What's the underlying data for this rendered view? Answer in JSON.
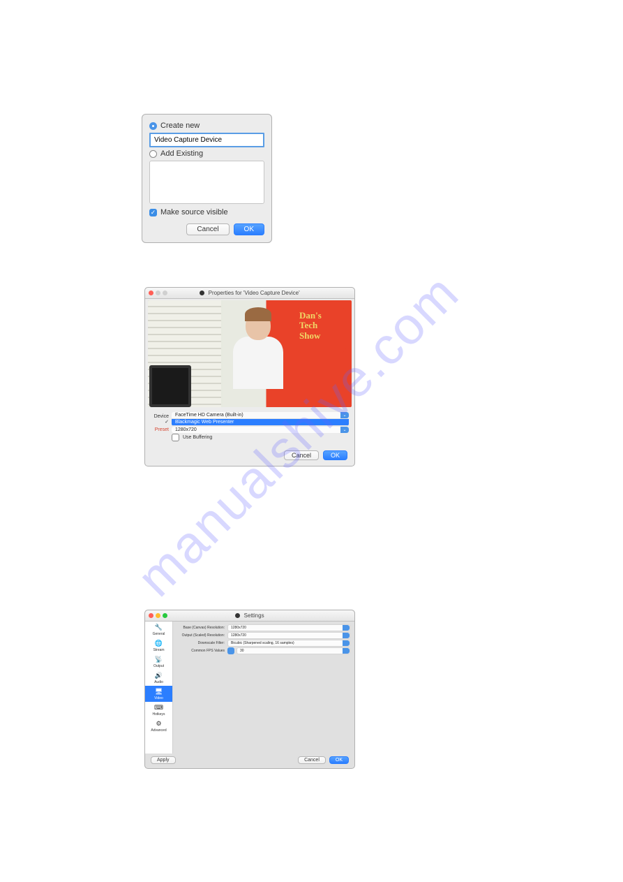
{
  "watermark": "manualshive.com",
  "dialog1": {
    "create_new_label": "Create new",
    "name_value": "Video Capture Device",
    "add_existing_label": "Add Existing",
    "make_visible_label": "Make source visible",
    "cancel": "Cancel",
    "ok": "OK"
  },
  "dialog2": {
    "title": "Properties for 'Video Capture Device'",
    "sign_line1": "Dan's",
    "sign_line2": "Tech",
    "sign_line3": "Show",
    "device_label": "Device",
    "device_option1": "FaceTime HD Camera (Built-in)",
    "device_option2": "Blackmagic Web Presenter",
    "preset_label": "Preset",
    "preset_value": "1280x720",
    "buffering_label": "Use Buffering",
    "cancel": "Cancel",
    "ok": "OK"
  },
  "dialog3": {
    "title": "Settings",
    "sidebar": {
      "general": "General",
      "stream": "Stream",
      "output": "Output",
      "audio": "Audio",
      "video": "Video",
      "hotkeys": "Hotkeys",
      "advanced": "Advanced"
    },
    "rows": {
      "base_res_label": "Base (Canvas) Resolution:",
      "base_res_value": "1280x720",
      "output_res_label": "Output (Scaled) Resolution:",
      "output_res_value": "1280x720",
      "downscale_label": "Downscale Filter:",
      "downscale_value": "Bicubic (Sharpened scaling, 16 samples)",
      "fps_label": "Common FPS Values",
      "fps_value": "30"
    },
    "apply": "Apply",
    "cancel": "Cancel",
    "ok": "OK"
  }
}
